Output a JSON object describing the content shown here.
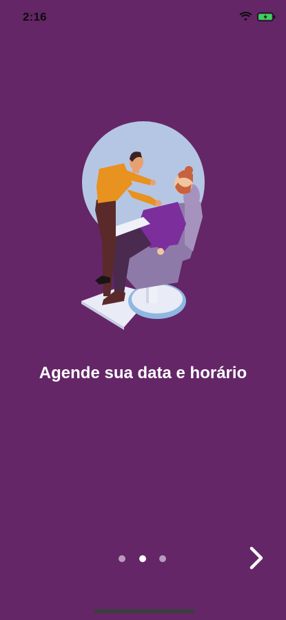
{
  "status_bar": {
    "time": "2:16",
    "icons": [
      "wifi-icon",
      "battery-charging-icon"
    ]
  },
  "onboarding": {
    "illustration": "barber-shaving-client-illustration",
    "headline": "Agende sua data e horário",
    "page_count": 3,
    "current_page": 2,
    "next_icon": "chevron-right-icon"
  },
  "colors": {
    "background": "#642667",
    "text": "#ffffff",
    "dot_inactive": "#b99bbd",
    "dot_active": "#ffffff",
    "battery": "#3bd15b"
  }
}
